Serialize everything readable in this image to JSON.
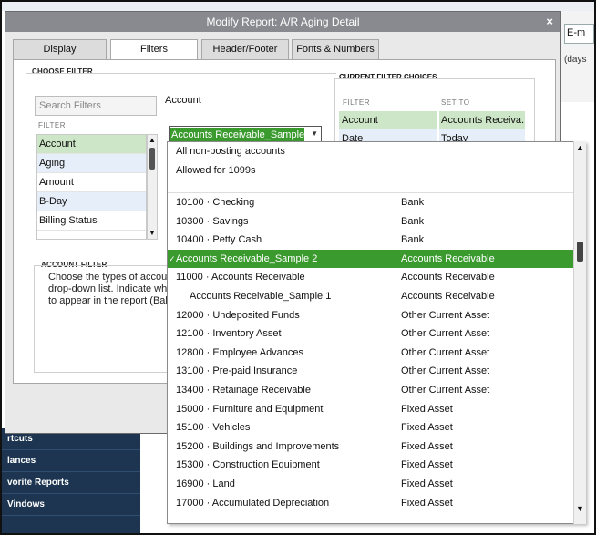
{
  "background": {
    "email_button": "E-m",
    "days_text": "(days",
    "sidebar": [
      "rtcuts",
      "lances",
      "vorite Reports",
      "Vindows"
    ]
  },
  "dialog": {
    "title": "Modify Report: A/R Aging Detail",
    "close": "×",
    "tabs": [
      "Display",
      "Filters",
      "Header/Footer",
      "Fonts & Numbers"
    ],
    "choose_filter_label": "CHOOSE FILTER",
    "search_placeholder": "Search Filters",
    "filter_column_header": "FILTER",
    "filters": [
      "Account",
      "Aging",
      "Amount",
      "B-Day",
      "Billing Status"
    ],
    "account_label": "Account",
    "account_selected": "Accounts Receivable_Sample 2",
    "account_filter_label": "ACCOUNT FILTER",
    "account_filter_description": "Choose the types of accoun drop-down list. Indicate whe to appear in the report (Bala",
    "current_filter_label": "CURRENT FILTER CHOICES",
    "current_filter_headers": [
      "FILTER",
      "SET TO"
    ],
    "current_filters": [
      {
        "filter": "Account",
        "set_to": "Accounts Receiva..."
      },
      {
        "filter": "Date",
        "set_to": "Today"
      }
    ]
  },
  "dropdown": {
    "top_items": [
      "All non-posting accounts",
      "Allowed for 1099s"
    ],
    "accounts": [
      {
        "name": "10100 · Checking",
        "type": "Bank"
      },
      {
        "name": "10300 · Savings",
        "type": "Bank"
      },
      {
        "name": "10400 · Petty Cash",
        "type": "Bank"
      },
      {
        "name": "Accounts Receivable_Sample 2",
        "type": "Accounts Receivable"
      },
      {
        "name": "11000 · Accounts Receivable",
        "type": "Accounts Receivable"
      },
      {
        "name": "Accounts Receivable_Sample 1",
        "type": "Accounts Receivable"
      },
      {
        "name": "12000 · Undeposited Funds",
        "type": "Other Current Asset"
      },
      {
        "name": "12100 · Inventory Asset",
        "type": "Other Current Asset"
      },
      {
        "name": "12800 · Employee Advances",
        "type": "Other Current Asset"
      },
      {
        "name": "13100 · Pre-paid Insurance",
        "type": "Other Current Asset"
      },
      {
        "name": "13400 · Retainage Receivable",
        "type": "Other Current Asset"
      },
      {
        "name": "15000 · Furniture and Equipment",
        "type": "Fixed Asset"
      },
      {
        "name": "15100 · Vehicles",
        "type": "Fixed Asset"
      },
      {
        "name": "15200 · Buildings and Improvements",
        "type": "Fixed Asset"
      },
      {
        "name": "15300 · Construction Equipment",
        "type": "Fixed Asset"
      },
      {
        "name": "16900 · Land",
        "type": "Fixed Asset"
      },
      {
        "name": "17000 · Accumulated Depreciation",
        "type": "Fixed Asset"
      }
    ],
    "selected_index": 3,
    "check_mark": "✓"
  },
  "colors": {
    "selection_green": "#3a9a2e",
    "light_green": "#cde6c7",
    "sidebar_navy": "#1d3550"
  }
}
